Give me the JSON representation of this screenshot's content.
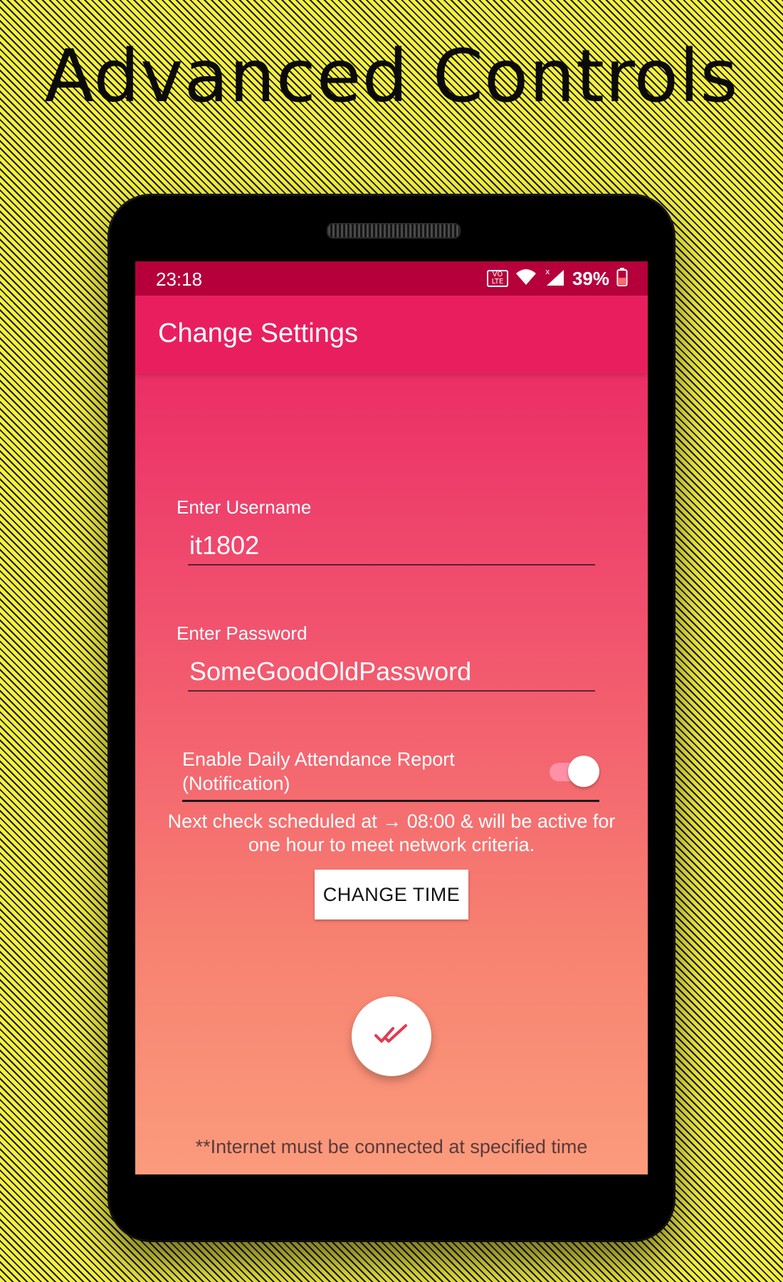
{
  "promo": {
    "headline": "Advanced Controls"
  },
  "status_bar": {
    "time": "23:18",
    "volte_top": "VO",
    "volte_bottom": "LTE",
    "battery_text": "39%",
    "icons": [
      "volte-icon",
      "wifi-icon",
      "signal-icon",
      "battery-icon"
    ]
  },
  "app_bar": {
    "title": "Change Settings"
  },
  "form": {
    "username_label": "Enter Username",
    "username_value": "it1802",
    "password_label": "Enter Password",
    "password_value": "SomeGoodOldPassword",
    "toggle_label": "Enable Daily Attendance Report (Notification)",
    "toggle_on": true,
    "schedule_text": "Next check scheduled at → 08:00 & will be active for one hour to meet network criteria.",
    "change_time_button": "CHANGE TIME",
    "footnote": "**Internet must be connected at specified time"
  },
  "colors": {
    "status_bar": "#b5003b",
    "app_bar": "#e91e5f",
    "gradient_top": "#e91e5f",
    "gradient_bottom": "#fb9b7c",
    "accent_check": "#e53950"
  }
}
